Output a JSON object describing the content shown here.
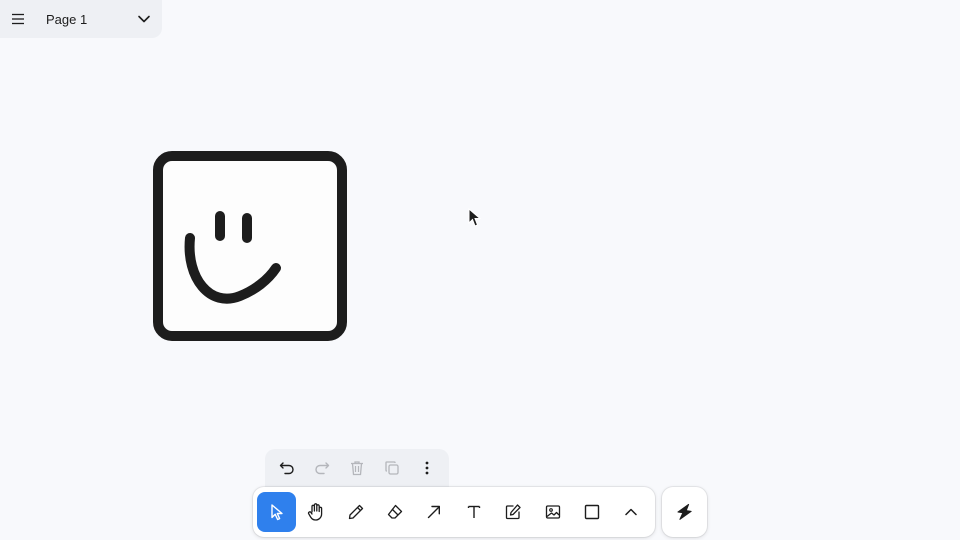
{
  "page_menu": {
    "page_name": "Page 1",
    "menu_icon": "hamburger-icon",
    "dropdown_icon": "chevron-down-icon"
  },
  "quick_actions": [
    {
      "name": "undo",
      "icon": "undo-icon"
    },
    {
      "name": "redo",
      "icon": "redo-icon"
    },
    {
      "name": "delete",
      "icon": "trash-icon"
    },
    {
      "name": "duplicate",
      "icon": "duplicate-icon"
    },
    {
      "name": "more",
      "icon": "more-vertical-icon"
    }
  ],
  "tools": [
    {
      "name": "select",
      "icon": "cursor-icon",
      "active": true
    },
    {
      "name": "hand",
      "icon": "hand-icon"
    },
    {
      "name": "draw",
      "icon": "pencil-icon"
    },
    {
      "name": "eraser",
      "icon": "eraser-icon"
    },
    {
      "name": "arrow",
      "icon": "arrow-icon"
    },
    {
      "name": "text",
      "icon": "text-icon"
    },
    {
      "name": "note",
      "icon": "note-edit-icon"
    },
    {
      "name": "asset",
      "icon": "image-icon"
    },
    {
      "name": "rectangle",
      "icon": "rectangle-icon"
    },
    {
      "name": "more-tools",
      "icon": "chevron-up-icon"
    }
  ],
  "help": {
    "icon": "lightning-logo-icon"
  },
  "colors": {
    "accent": "#2f80ed",
    "stroke": "#1d1d1d",
    "background": "#f8f9fc"
  }
}
